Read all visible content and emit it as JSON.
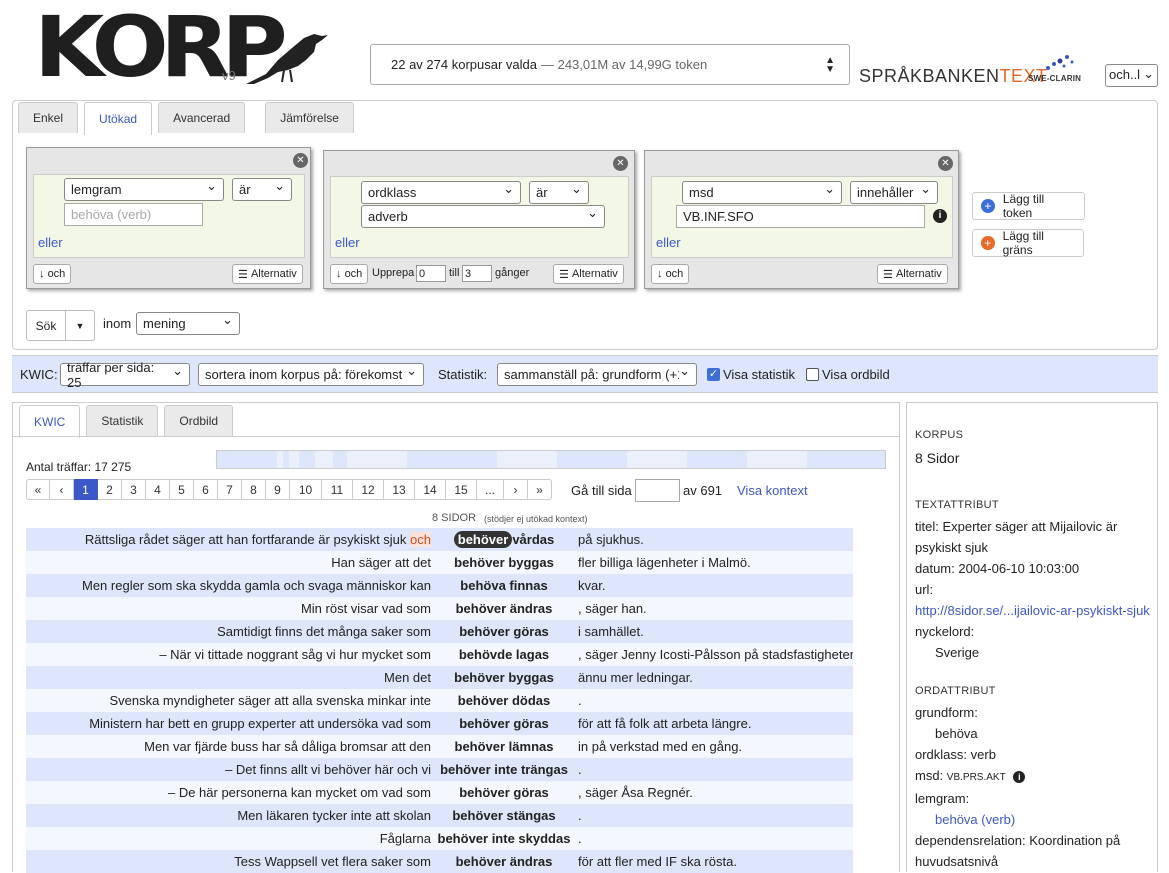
{
  "header": {
    "logo_text": "KORP",
    "version": "v9",
    "corpus_summary": "22 av 274 korpusar valda",
    "corpus_tokens": "— 243,01M av 14,99G token",
    "brand_prefix": "SPRÅKBANKEN",
    "brand_suffix": "TEXT",
    "clarin": "SWE-CLARIN",
    "language": "och..l"
  },
  "search_tabs": [
    "Enkel",
    "Utökad",
    "Avancerad",
    "Jämförelse"
  ],
  "tokens": [
    {
      "attr": "lemgram",
      "op": "är",
      "value_placeholder": "behöva (verb)",
      "or": "eller",
      "and": "och",
      "alt": "Alternativ"
    },
    {
      "attr": "ordklass",
      "op": "är",
      "value": "adverb",
      "or": "eller",
      "and": "och",
      "repeat": "Upprepa",
      "from": "0",
      "till": "till",
      "to": "3",
      "times": "gånger",
      "alt": "Alternativ"
    },
    {
      "attr": "msd",
      "op": "innehåller",
      "value": "VB.INF.SFO",
      "or": "eller",
      "and": "och",
      "alt": "Alternativ"
    }
  ],
  "add_token": "Lägg till token",
  "add_boundary": "Lägg till gräns",
  "search": {
    "button": "Sök",
    "within": "inom",
    "unit": "mening"
  },
  "kwic_bar": {
    "label": "KWIC:",
    "per_page": "träffar per sida: 25",
    "sort": "sortera inom korpus på: förekomst",
    "stats_label": "Statistik:",
    "stats_select": "sammanställ på: grundform (+1)",
    "show_stats": "Visa statistik",
    "show_wordpic": "Visa ordbild"
  },
  "result_tabs": [
    "KWIC",
    "Statistik",
    "Ordbild"
  ],
  "hits_label": "Antal träffar: 17 275",
  "pager": {
    "pages": [
      "«",
      "‹",
      "1",
      "2",
      "3",
      "4",
      "5",
      "6",
      "7",
      "8",
      "9",
      "10",
      "11",
      "12",
      "13",
      "14",
      "15",
      "...",
      "›",
      "»"
    ],
    "goto": "Gå till sida",
    "of": "av 691",
    "context": "Visa kontext"
  },
  "corpus_heading": "8 SIDOR",
  "corpus_note": "(stödjer ej utökad kontext)",
  "kwic_rows": [
    {
      "left": "Rättsliga rådet säger att han fortfarande är psykiskt sjuk",
      "left_extra": "och",
      "match_a": "behöver",
      "match_b": "vårdas",
      "right": "på sjukhus."
    },
    {
      "left": "Han säger att det",
      "match": "behöver byggas",
      "right": "fler billiga lägenheter i Malmö."
    },
    {
      "left": "Men regler som ska skydda gamla och svaga människor kan",
      "match": "behöva finnas",
      "right": "kvar."
    },
    {
      "left": "Min röst visar vad som",
      "match": "behöver ändras",
      "right": ", säger han."
    },
    {
      "left": "Samtidigt finns det många saker som",
      "match": "behöver göras",
      "right": "i samhället."
    },
    {
      "left": "– När vi tittade noggrant såg vi hur mycket som",
      "match": "behövde lagas",
      "right": ", säger Jenny Icosti-Pålsson på stadsfastigheter."
    },
    {
      "left": "Men det",
      "match": "behöver byggas",
      "right": "ännu mer ledningar."
    },
    {
      "left": "Svenska myndigheter säger att alla svenska minkar inte",
      "match": "behöver dödas",
      "right": "."
    },
    {
      "left": "Ministern har bett en grupp experter att undersöka vad som",
      "match": "behöver göras",
      "right": "för att få folk att arbeta längre."
    },
    {
      "left": "Men var fjärde buss har så dåliga bromsar att den",
      "match": "behöver lämnas",
      "right": "in på verkstad med en gång."
    },
    {
      "left": "– Det finns allt vi behöver här och vi",
      "match": "behöver inte trängas",
      "right": "."
    },
    {
      "left": "– De här personerna kan mycket om vad som",
      "match": "behöver göras",
      "right": ", säger Åsa Regnér."
    },
    {
      "left": "Men läkaren tycker inte att skolan",
      "match": "behöver stängas",
      "right": "."
    },
    {
      "left": "Fåglarna",
      "match": "behöver inte skyddas",
      "right": "."
    },
    {
      "left": "Tess Wappsell vet flera saker som",
      "match": "behöver ändras",
      "right": "för att fler med IF ska rösta."
    }
  ],
  "sidebar": {
    "korpus_h": "KORPUS",
    "korpus": "8 Sidor",
    "textattr_h": "TEXTATTRIBUT",
    "titel": "titel: Experter säger att Mijailovic är psykiskt sjuk",
    "datum": "datum: 2004-06-10 10:03:00",
    "url_label": "url:",
    "url": "http://8sidor.se/...ijailovic-ar-psykiskt-sjuk",
    "nyckelord_label": "nyckelord:",
    "nyckelord": "Sverige",
    "ordattr_h": "ORDATTRIBUT",
    "grundform_label": "grundform:",
    "grundform": "behöva",
    "ordklass": "ordklass: verb",
    "msd_label": "msd:",
    "msd": "VB.PRS.AKT",
    "lemgram_label": "lemgram:",
    "lemgram": "behöva (verb)",
    "dependens": "dependensrelation: Koordination på huvudsatsnivå"
  }
}
